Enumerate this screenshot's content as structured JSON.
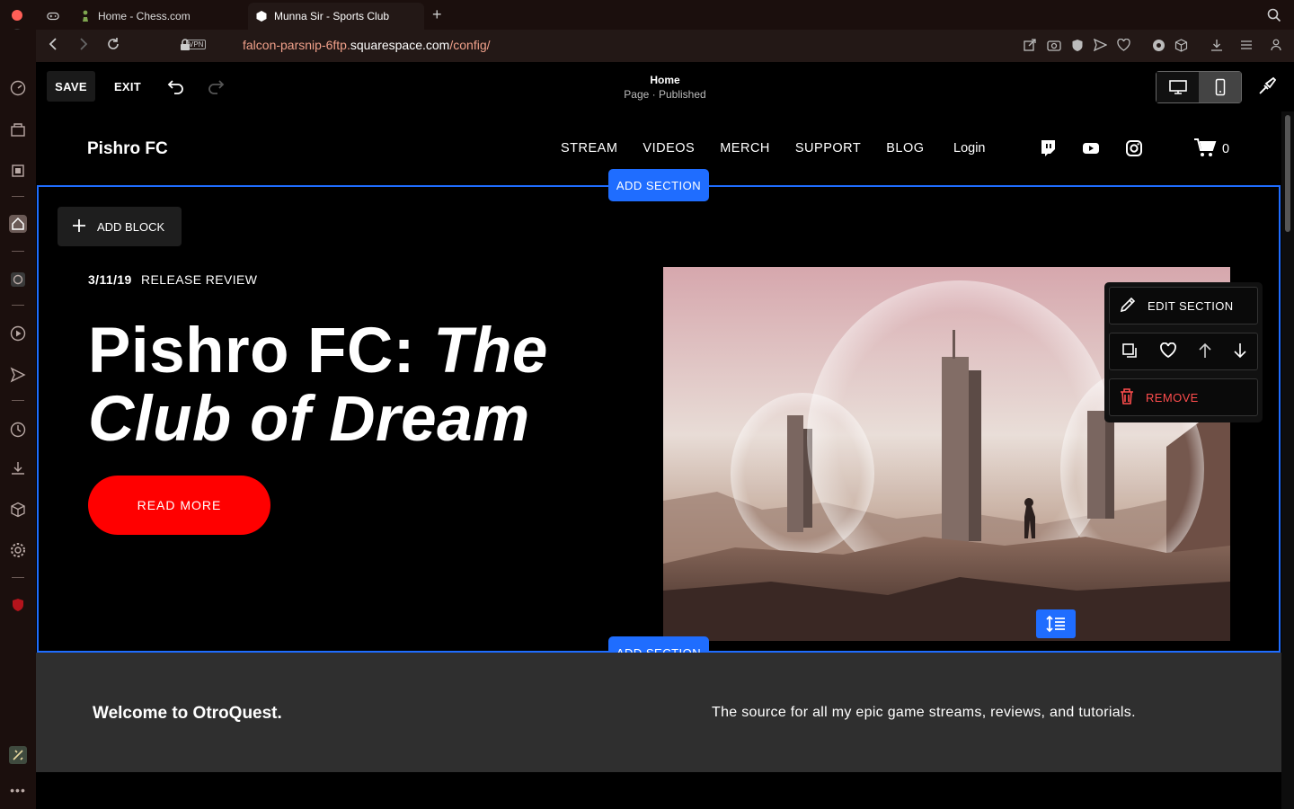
{
  "browser": {
    "tabs": [
      {
        "label": ""
      },
      {
        "label": "Home - Chess.com"
      },
      {
        "label": "Munna Sir - Sports Club"
      }
    ],
    "vpn_label": "VPN",
    "url_prefix": "falcon-parsnip-6ftp.",
    "url_domain": "squarespace.com",
    "url_path": "/config/"
  },
  "editor": {
    "save_label": "SAVE",
    "exit_label": "EXIT",
    "page_name": "Home",
    "page_status": "Page · Published"
  },
  "site": {
    "logo": "Pishro FC",
    "menu": [
      "STREAM",
      "VIDEOS",
      "MERCH",
      "SUPPORT",
      "BLOG"
    ],
    "login_label": "Login",
    "cart_count": "0",
    "add_section_label": "ADD SECTION",
    "add_block_label": "ADD BLOCK",
    "hero": {
      "date": "3/11/19",
      "category": "RELEASE REVIEW",
      "title_plain": "Pishro FC: ",
      "title_italic_1": "The",
      "title_italic_2": "Club of Dream",
      "cta_label": "READ MORE"
    },
    "section_menu": {
      "edit_label": "EDIT SECTION",
      "remove_label": "REMOVE"
    },
    "welcome": {
      "heading": "Welcome to OtroQuest.",
      "text": "The source for all my epic game streams, reviews, and tutorials."
    }
  },
  "colors": {
    "accent_blue": "#1f6dff",
    "cta_red": "#ff0000",
    "remove_red": "#ff4d4d"
  }
}
